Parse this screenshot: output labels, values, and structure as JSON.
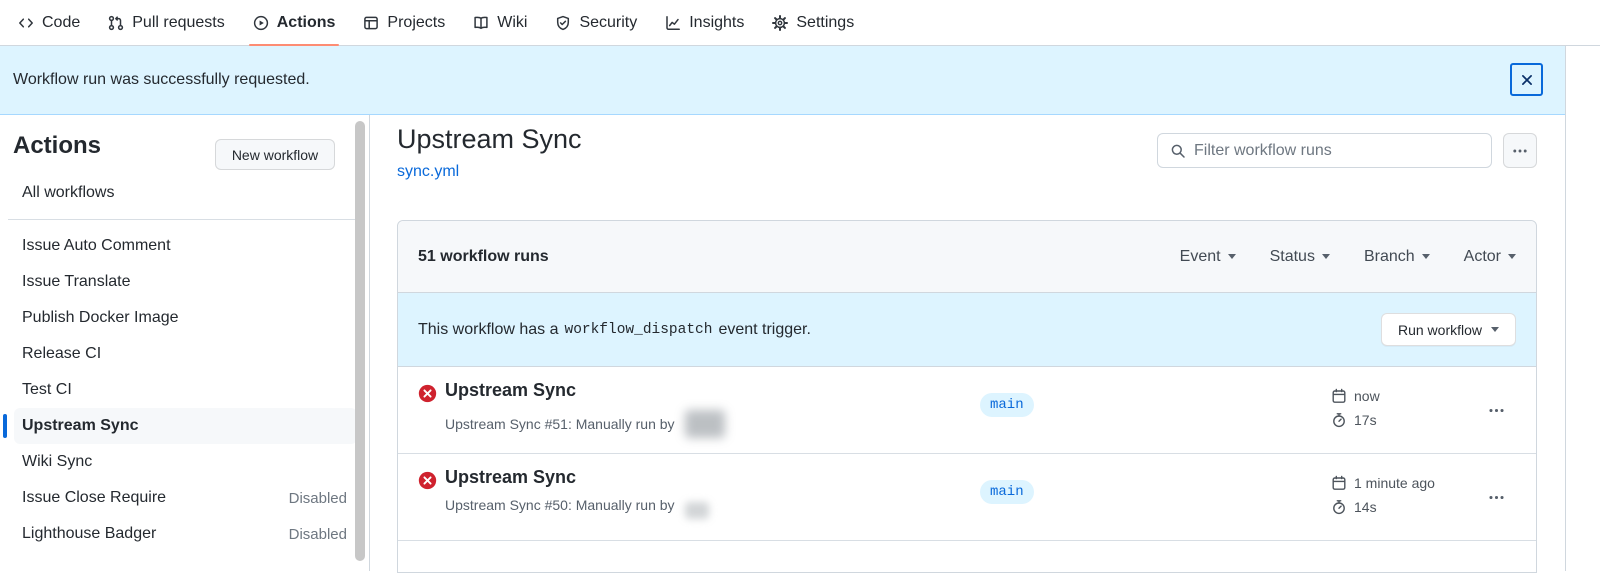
{
  "nav": {
    "tabs": [
      {
        "label": "Code",
        "icon": "code-icon",
        "active": false
      },
      {
        "label": "Pull requests",
        "icon": "git-pull-request-icon",
        "active": false
      },
      {
        "label": "Actions",
        "icon": "play-icon",
        "active": true
      },
      {
        "label": "Projects",
        "icon": "table-icon",
        "active": false
      },
      {
        "label": "Wiki",
        "icon": "book-icon",
        "active": false
      },
      {
        "label": "Security",
        "icon": "shield-icon",
        "active": false
      },
      {
        "label": "Insights",
        "icon": "graph-icon",
        "active": false
      },
      {
        "label": "Settings",
        "icon": "gear-icon",
        "active": false
      }
    ]
  },
  "flash": {
    "message": "Workflow run was successfully requested."
  },
  "sidebar": {
    "title": "Actions",
    "new_workflow_label": "New workflow",
    "all_workflows_label": "All workflows",
    "items": [
      {
        "label": "Issue Auto Comment"
      },
      {
        "label": "Issue Translate"
      },
      {
        "label": "Publish Docker Image"
      },
      {
        "label": "Release CI"
      },
      {
        "label": "Test CI"
      },
      {
        "label": "Upstream Sync",
        "selected": true
      },
      {
        "label": "Wiki Sync"
      },
      {
        "label": "Issue Close Require",
        "badge": "Disabled"
      },
      {
        "label": "Lighthouse Badger",
        "badge": "Disabled"
      }
    ]
  },
  "main": {
    "title": "Upstream Sync",
    "workflow_file": "sync.yml",
    "filter_placeholder": "Filter workflow runs",
    "runs_panel": {
      "count_label": "51 workflow runs",
      "filters": [
        "Event",
        "Status",
        "Branch",
        "Actor"
      ],
      "notice": {
        "text_before": "This workflow has a",
        "code": "workflow_dispatch",
        "text_after": "event trigger."
      },
      "run_workflow_label": "Run workflow",
      "runs": [
        {
          "title": "Upstream Sync",
          "status": "failure",
          "description": "Upstream Sync #51: Manually run by",
          "branch": "main",
          "time": "now",
          "duration": "17s"
        },
        {
          "title": "Upstream Sync",
          "status": "failure",
          "description": "Upstream Sync #50: Manually run by",
          "branch": "main",
          "time": "1 minute ago",
          "duration": "14s"
        }
      ]
    }
  },
  "colors": {
    "active_tab_underline": "#fd8c73",
    "flash_background": "#ddf4ff",
    "link_blue": "#0969da",
    "failure_red": "#cf222e",
    "branch_badge_bg": "#ddf4ff",
    "branch_badge_text": "#0969da",
    "card_border": "#d0d7de",
    "card_header_bg": "#f6f8fa",
    "disabled_text": "#6e7781"
  }
}
